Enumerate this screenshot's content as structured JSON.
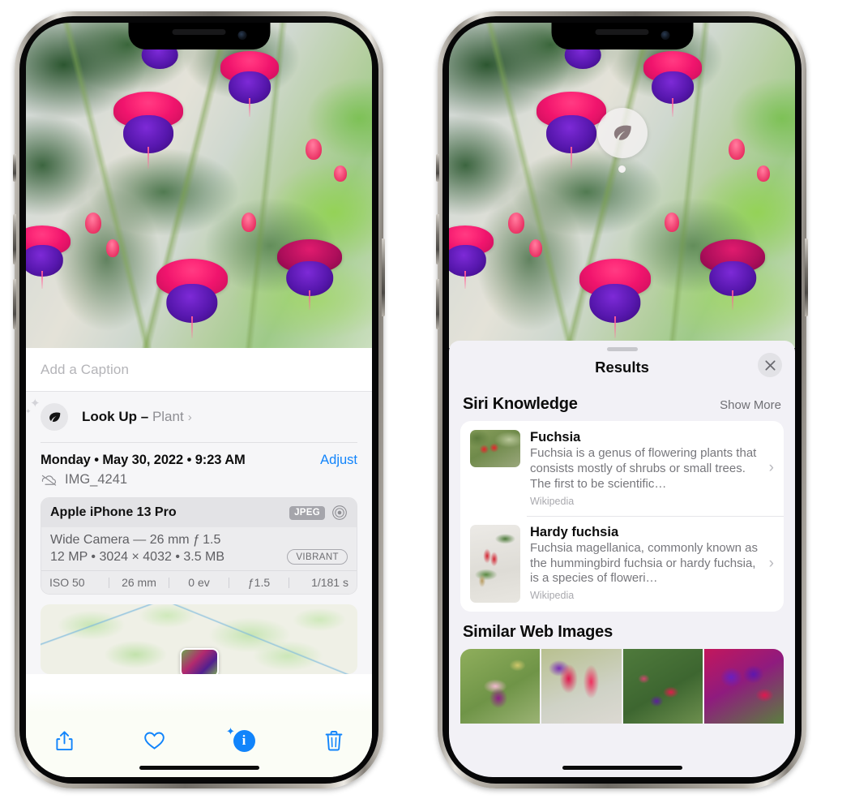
{
  "left_phone": {
    "photo": {
      "alt": "fuchsia-flowers-photo"
    },
    "caption_field": {
      "placeholder": "Add a Caption",
      "value": ""
    },
    "look_up": {
      "label": "Look Up",
      "dash": "–",
      "subject": "Plant",
      "chevron": "›",
      "icon": "leaf-icon"
    },
    "date_row": {
      "datetime": "Monday • May 30, 2022 • 9:23 AM",
      "adjust_label": "Adjust"
    },
    "filename_row": {
      "cloud_icon": "cloud-slash-icon",
      "filename": "IMG_4241"
    },
    "metadata": {
      "device": "Apple iPhone 13 Pro",
      "format_badge": "JPEG",
      "aperture_icon": "aperture-icon",
      "lens": "Wide Camera — 26 mm ƒ 1.5",
      "size_line": "12 MP • 3024 × 4032 • 3.5 MB",
      "style_badge": "VIBRANT",
      "exif": [
        "ISO 50",
        "26 mm",
        "0 ev",
        "ƒ1.5",
        "1/181 s"
      ]
    },
    "map": {
      "name": "location-map"
    },
    "toolbar": [
      {
        "name": "share-button",
        "icon": "share-icon"
      },
      {
        "name": "favorite-button",
        "icon": "heart-icon"
      },
      {
        "name": "info-button",
        "icon": "info-sparkle-icon",
        "label": "i",
        "active": true
      },
      {
        "name": "delete-button",
        "icon": "trash-icon"
      }
    ]
  },
  "right_phone": {
    "photo": {
      "alt": "fuchsia-flowers-photo"
    },
    "visual_lookup_marker": {
      "icon": "leaf-icon"
    },
    "sheet": {
      "title": "Results",
      "close_icon": "close-icon",
      "siri_knowledge": {
        "title": "Siri Knowledge",
        "show_more": "Show More",
        "items": [
          {
            "title": "Fuchsia",
            "description": "Fuchsia is a genus of flowering plants that consists mostly of shrubs or small trees. The first to be scientific…",
            "source": "Wikipedia",
            "thumbnail": "red-fuchsia-thumbnail",
            "chevron": "›"
          },
          {
            "title": "Hardy fuchsia",
            "description": "Fuchsia magellanica, commonly known as the hummingbird fuchsia or hardy fuchsia, is a species of floweri…",
            "source": "Wikipedia",
            "thumbnail": "hardy-fuchsia-thumbnail",
            "chevron": "›"
          }
        ]
      },
      "similar_web_images": {
        "title": "Similar Web Images",
        "items": [
          {
            "name": "web-image-1"
          },
          {
            "name": "web-image-2"
          },
          {
            "name": "web-image-3"
          },
          {
            "name": "web-image-4"
          }
        ]
      }
    }
  },
  "colors": {
    "accent_blue": "#1184fb",
    "sheet_bg": "#f2f1f6",
    "card_bg": "#ffffff",
    "secondary_text": "#8e8e93",
    "badge_gray": "#a5a5ab"
  }
}
